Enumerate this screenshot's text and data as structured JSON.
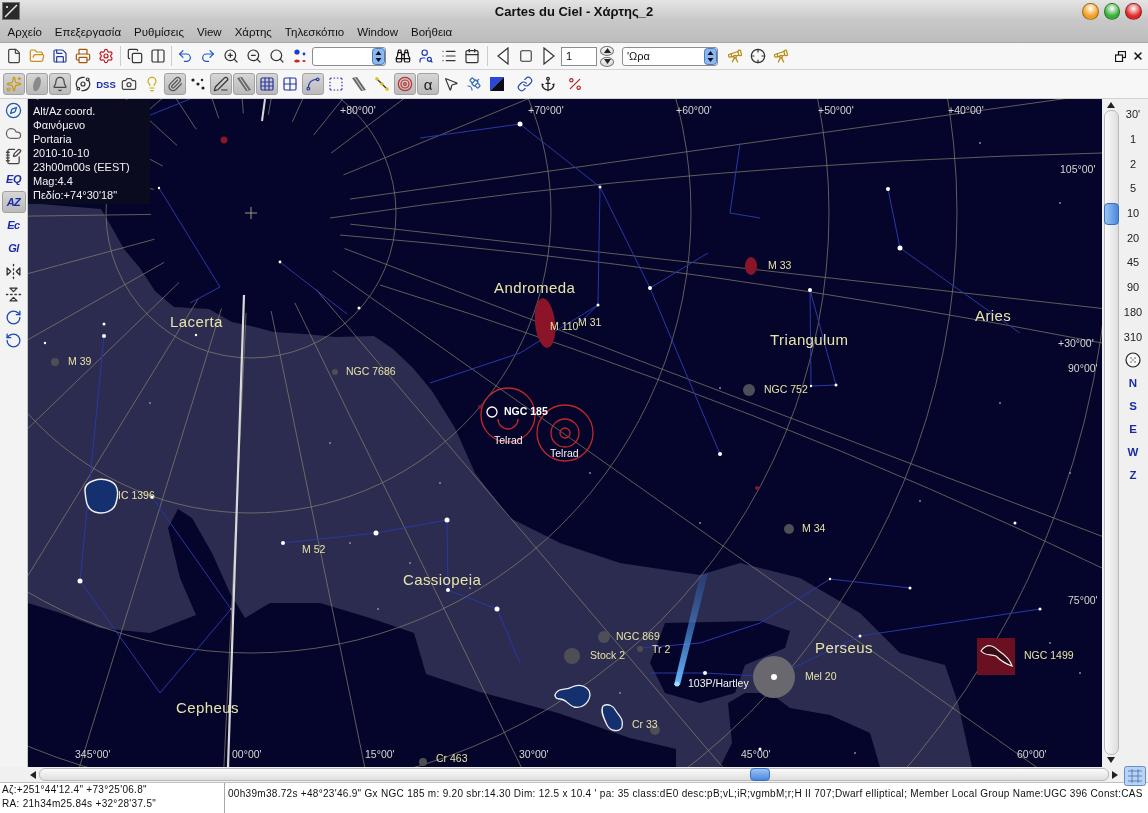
{
  "window": {
    "title": "Cartes du Ciel - Χάρτης_2"
  },
  "menu": [
    "Αρχείο",
    "Επεξεργασία",
    "Ρυθμίσεις",
    "View",
    "Χάρτης",
    "Τηλεσκόπιο",
    "Window",
    "Βοήθεια"
  ],
  "main_toolbar": {
    "page_field": "1",
    "time_unit": "'Ωρα"
  },
  "object_toolbar": [
    {
      "pressed": true
    },
    {
      "pressed": true
    },
    {
      "pressed": true
    },
    {
      "pressed": false
    },
    {
      "label": "DSS",
      "pressed": false
    },
    {
      "pressed": false
    },
    {
      "pressed": false
    },
    {
      "pressed": true
    },
    {
      "pressed": false
    },
    {
      "pressed": true
    },
    {
      "pressed": true
    },
    {
      "pressed": true
    },
    {
      "pressed": false
    },
    {
      "pressed": true
    },
    {
      "pressed": false
    },
    {
      "pressed": false
    },
    {
      "pressed": false
    },
    {
      "pressed": true
    },
    {
      "label": "α",
      "pressed": true
    },
    {
      "pressed": false
    },
    {
      "pressed": false
    },
    {
      "pressed": false
    },
    {
      "pressed": false
    },
    {
      "pressed": false
    },
    {
      "pressed": false
    }
  ],
  "side_toolbar": [
    {
      "pressed": false
    },
    {
      "pressed": false
    },
    {
      "pressed": false
    },
    {
      "label": "EQ",
      "pressed": false
    },
    {
      "label": "AZ",
      "pressed": true
    },
    {
      "label": "Ec",
      "pressed": false
    },
    {
      "label": "Gl",
      "pressed": false
    },
    {
      "pressed": false
    },
    {
      "pressed": false
    },
    {
      "pressed": false
    },
    {
      "pressed": false
    }
  ],
  "chart": {
    "info": [
      "Alt/Az coord.",
      "Φαινόμενο",
      "Portaria",
      "2010-10-10",
      "23h00m00s (EEST)",
      "Mag:4.4",
      "Πεδίο:+74°30'18\""
    ],
    "grid_labels": [
      "+80°00'",
      "+70°00'",
      "+60°00'",
      "+50°00'",
      "+40°00'",
      "105°00'",
      "+30°00'",
      "90°00'",
      "75°00'",
      "345°00'",
      "00°00'",
      "15°00'",
      "30°00'",
      "45°00'",
      "60°00'"
    ],
    "constellations": [
      "Andromeda",
      "Lacerta",
      "Triangulum",
      "Aries",
      "Cassiopeia",
      "Perseus",
      "Cepheus"
    ],
    "objects": [
      {
        "label": "M 33",
        "kind": "deep_sky"
      },
      {
        "label": "M 110",
        "kind": "deep_sky"
      },
      {
        "label": "M 31",
        "kind": "deep_sky"
      },
      {
        "label": "NGC 7686",
        "kind": "deep_sky"
      },
      {
        "label": "M 39",
        "kind": "deep_sky"
      },
      {
        "label": "NGC 752",
        "kind": "deep_sky"
      },
      {
        "label": "NGC 185",
        "kind": "identified"
      },
      {
        "label": "Telrad",
        "kind": "telrad"
      },
      {
        "label": "Telrad",
        "kind": "telrad"
      },
      {
        "label": "IC 1396",
        "kind": "deep_sky"
      },
      {
        "label": "M 52",
        "kind": "deep_sky"
      },
      {
        "label": "M 34",
        "kind": "deep_sky"
      },
      {
        "label": "NGC 869",
        "kind": "deep_sky"
      },
      {
        "label": "Stock 2",
        "kind": "deep_sky"
      },
      {
        "label": "Tr 2",
        "kind": "deep_sky"
      },
      {
        "label": "103P/Hartley",
        "kind": "comet"
      },
      {
        "label": "Mel 20",
        "kind": "deep_sky"
      },
      {
        "label": "Cr 33",
        "kind": "deep_sky"
      },
      {
        "label": "Cr 463",
        "kind": "deep_sky"
      },
      {
        "label": "NGC 1499",
        "kind": "deep_sky"
      }
    ]
  },
  "zoom_scale": [
    "30'",
    "1",
    "2",
    "5",
    "10",
    "20",
    "45",
    "90",
    "180",
    "310"
  ],
  "directions": [
    "N",
    "S",
    "E",
    "W",
    "Z"
  ],
  "status_bar": {
    "coordinates": [
      "Αζ:+251°44'12.4\" +73°25'06.8\"",
      "RA: 21h34m25.84s +32°28'37.5\""
    ],
    "object_info": "00h39m38.72s +48°23'46.9\" Gx NGC 185 m: 9.20 sbr:14.30 Dim: 12.5 x 10.4 ' pa: 35 class:dE0 desc:pB;vL;iR;vgmbM;r;H II 707;Dwarf elliptical; Member Local Group Name:UGC 396 Const:CAS"
  }
}
